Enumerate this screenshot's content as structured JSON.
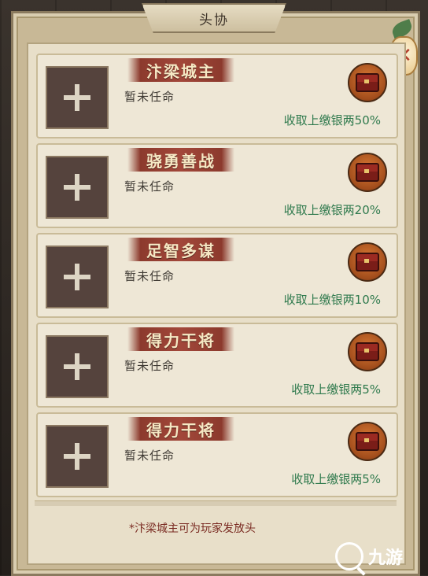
{
  "title": "头协",
  "cards": [
    {
      "rank": "汴梁城主",
      "status": "暂未任命",
      "reward": "收取上缴银两50%"
    },
    {
      "rank": "骁勇善战",
      "status": "暂未任命",
      "reward": "收取上缴银两20%"
    },
    {
      "rank": "足智多谋",
      "status": "暂未任命",
      "reward": "收取上缴银两10%"
    },
    {
      "rank": "得力干将",
      "status": "暂未任命",
      "reward": "收取上缴银两5%"
    },
    {
      "rank": "得力干将",
      "status": "暂未任命",
      "reward": "收取上缴银两5%"
    }
  ],
  "notice": "*汴梁城主可为玩家发放头",
  "watermark": "九游",
  "close_glyph": "✕",
  "icons": {
    "slot": "plus-icon",
    "reward": "treasure-chest-icon",
    "close": "lantern-close-icon",
    "watermark": "search-logo-icon"
  },
  "colors": {
    "reward_text": "#2f7a4d",
    "rank_ribbon": "#a2473a",
    "notice_text": "#7a2b22"
  }
}
